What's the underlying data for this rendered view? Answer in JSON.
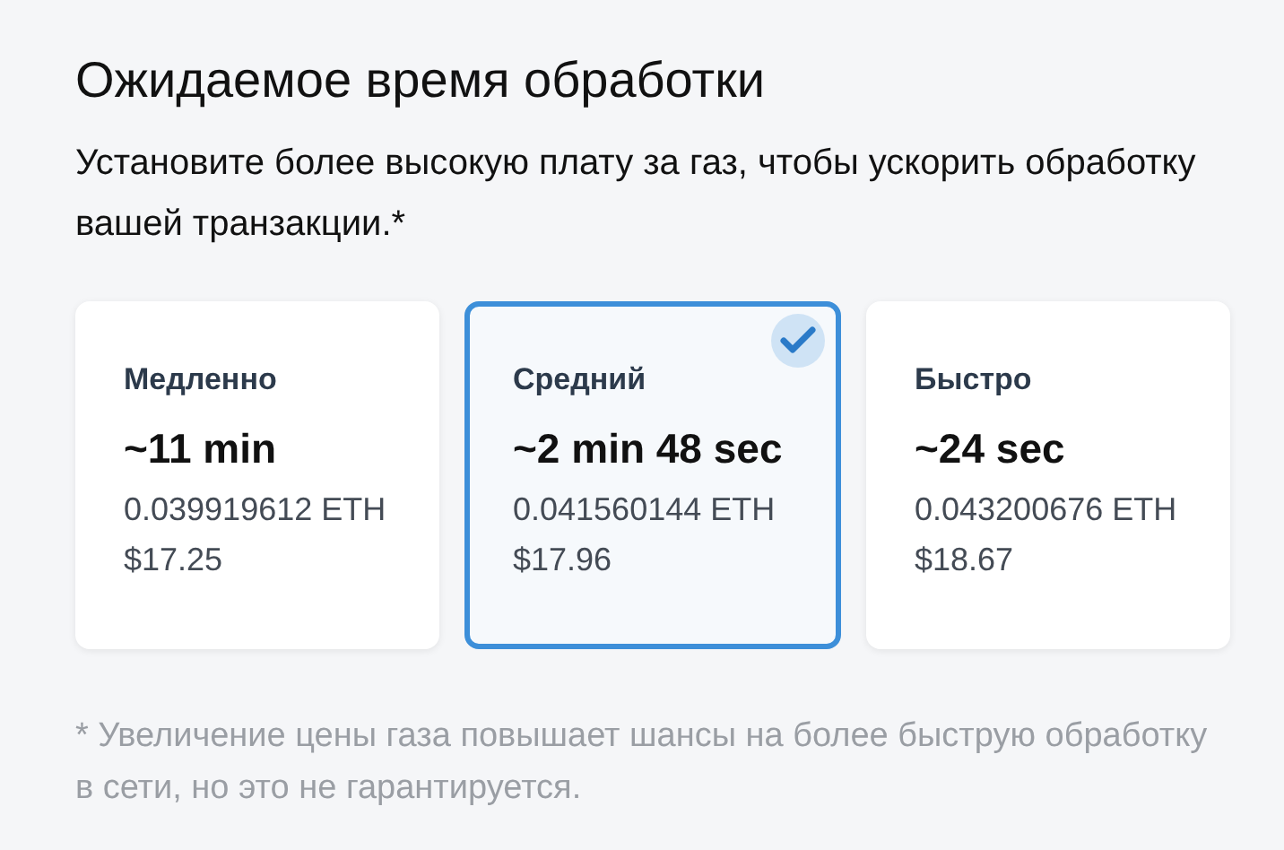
{
  "title": "Ожидаемое время обработки",
  "subtitle": "Установите более высокую плату за газ, чтобы ускорить обработку вашей транзакции.*",
  "options": [
    {
      "label": "Медленно",
      "time": "~11 min",
      "eth": "0.039919612 ETH",
      "usd": "$17.25",
      "selected": false
    },
    {
      "label": "Средний",
      "time": "~2 min 48 sec",
      "eth": "0.041560144 ETH",
      "usd": "$17.96",
      "selected": true
    },
    {
      "label": "Быстро",
      "time": "~24 sec",
      "eth": "0.043200676 ETH",
      "usd": "$18.67",
      "selected": false
    }
  ],
  "footnote": "* Увеличение цены газа повышает шансы на более быструю обработку в сети, но это не гарантируется."
}
